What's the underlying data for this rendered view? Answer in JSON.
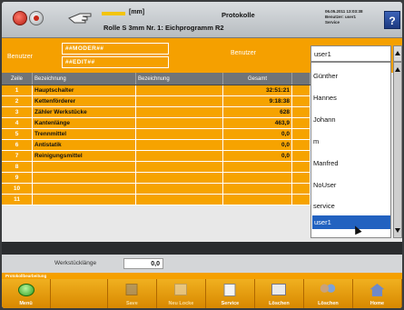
{
  "header": {
    "unit": "[mm]",
    "roll_info": "Rolle S 3mm Nr. 1: Eichprogramm R2",
    "title": "Protokolle",
    "datetime_lines": [
      "06.05.2011 13:03:38",
      "Benutzer: user1",
      "Service"
    ],
    "help_label": "?"
  },
  "userbar": {
    "benutzer_label": "Benutzer",
    "roles": [
      "##MODER##",
      "##EDIT##"
    ],
    "benutzer_label_right": "Benutzer",
    "selected_user": "user1"
  },
  "table": {
    "columns": [
      "Zeile",
      "Bezeichnung",
      "Bezeichnung",
      "Gesamt"
    ],
    "rows": [
      {
        "num": "1",
        "name": "Hauptschalter",
        "desc": "",
        "total": "32:51:21"
      },
      {
        "num": "2",
        "name": "Kettenförderer",
        "desc": "",
        "total": "9:18:38"
      },
      {
        "num": "3",
        "name": "Zähler Werkstücke",
        "desc": "",
        "total": "628"
      },
      {
        "num": "4",
        "name": "Kantenlänge",
        "desc": "",
        "total": "463,9"
      },
      {
        "num": "5",
        "name": "Trennmittel",
        "desc": "",
        "total": "0,0"
      },
      {
        "num": "6",
        "name": "Antistatik",
        "desc": "",
        "total": "0,0"
      },
      {
        "num": "7",
        "name": "Reinigungsmittel",
        "desc": "",
        "total": "0,0"
      },
      {
        "num": "8",
        "name": "",
        "desc": "",
        "total": ""
      },
      {
        "num": "9",
        "name": "",
        "desc": "",
        "total": ""
      },
      {
        "num": "10",
        "name": "",
        "desc": "",
        "total": ""
      },
      {
        "num": "11",
        "name": "",
        "desc": "",
        "total": ""
      }
    ]
  },
  "dropdown": {
    "items": [
      "Günther",
      "Hannes",
      "Johann",
      "m",
      "Manfred",
      "NoUser",
      "service"
    ],
    "selected": "user1"
  },
  "workpiece": {
    "label": "Werkstücklänge",
    "value": "0,0"
  },
  "status_text": "Protokollbearbeitung",
  "toolbar": [
    {
      "label": "Menü",
      "icon": "menu-icon",
      "enabled": true
    },
    {
      "label": "",
      "icon": "paper-icon",
      "enabled": true
    },
    {
      "label": "Save",
      "icon": "save-icon",
      "enabled": false
    },
    {
      "label": "Neu Locke",
      "icon": "copy-icon",
      "enabled": false
    },
    {
      "label": "Service",
      "icon": "service-icon",
      "enabled": true
    },
    {
      "label": "Löschen",
      "icon": "delete-icon",
      "enabled": true
    },
    {
      "label": "Löschen",
      "icon": "delete-users-icon",
      "enabled": true
    },
    {
      "label": "Home",
      "icon": "home-icon",
      "enabled": true
    }
  ],
  "colors": {
    "accent": "#f5a000",
    "header_gray": "#707478",
    "selection_blue": "#2262c0"
  }
}
